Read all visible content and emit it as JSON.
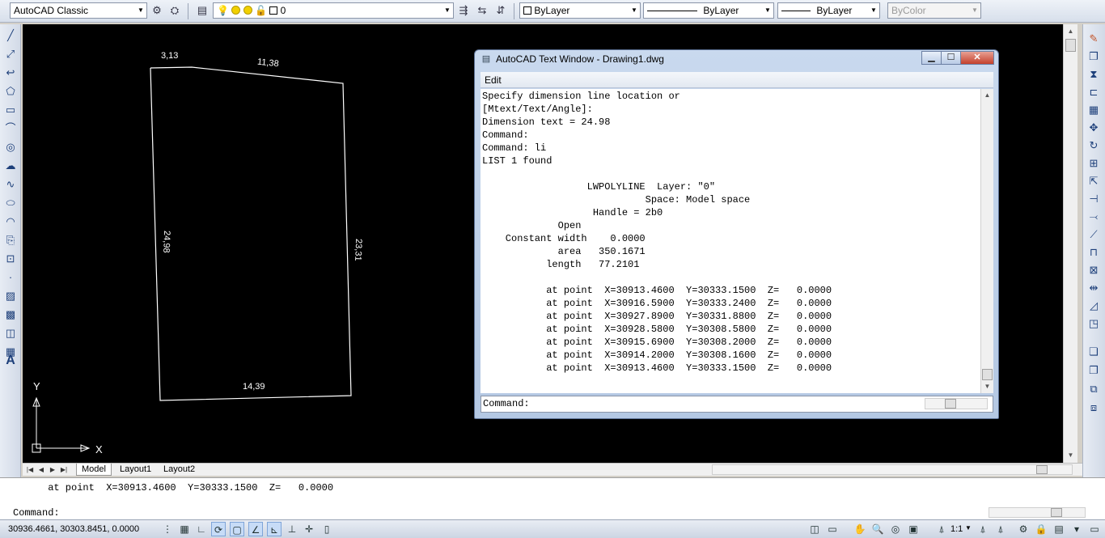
{
  "toolbar": {
    "workspace": "AutoCAD Classic",
    "layer": "0",
    "color": "ByLayer",
    "linetype": "ByLayer",
    "lineweight": "ByLayer",
    "plotstyle": "ByColor"
  },
  "drawing": {
    "dim_top_left": "3,13",
    "dim_top": "11,38",
    "dim_left": "24,98",
    "dim_right": "23,31",
    "dim_bottom": "14,39",
    "ucs_x": "X",
    "ucs_y": "Y"
  },
  "layout_tabs": [
    "Model",
    "Layout1",
    "Layout2"
  ],
  "command_line": {
    "history": "      at point  X=30913.4600  Y=30333.1500  Z=   0.0000",
    "prompt": "Command:"
  },
  "status": {
    "coords": "30936.4661, 30303.8451, 0.0000",
    "annotation_scale": "1:1"
  },
  "text_window": {
    "title": "AutoCAD Text Window - Drawing1.dwg",
    "menu_edit": "Edit",
    "lines": [
      "Specify dimension line location or",
      "[Mtext/Text/Angle]:",
      "Dimension text = 24.98",
      "Command:",
      "Command: li",
      "LIST 1 found",
      "",
      "                  LWPOLYLINE  Layer: \"0\"",
      "                            Space: Model space",
      "                   Handle = 2b0",
      "             Open",
      "    Constant width    0.0000",
      "             area   350.1671",
      "           length   77.2101",
      "",
      "           at point  X=30913.4600  Y=30333.1500  Z=   0.0000",
      "           at point  X=30916.5900  Y=30333.2400  Z=   0.0000",
      "           at point  X=30927.8900  Y=30331.8800  Z=   0.0000",
      "           at point  X=30928.5800  Y=30308.5800  Z=   0.0000",
      "           at point  X=30915.6900  Y=30308.2000  Z=   0.0000",
      "           at point  X=30914.2000  Y=30308.1600  Z=   0.0000",
      "           at point  X=30913.4600  Y=30333.1500  Z=   0.0000"
    ],
    "prompt": "Command:"
  }
}
